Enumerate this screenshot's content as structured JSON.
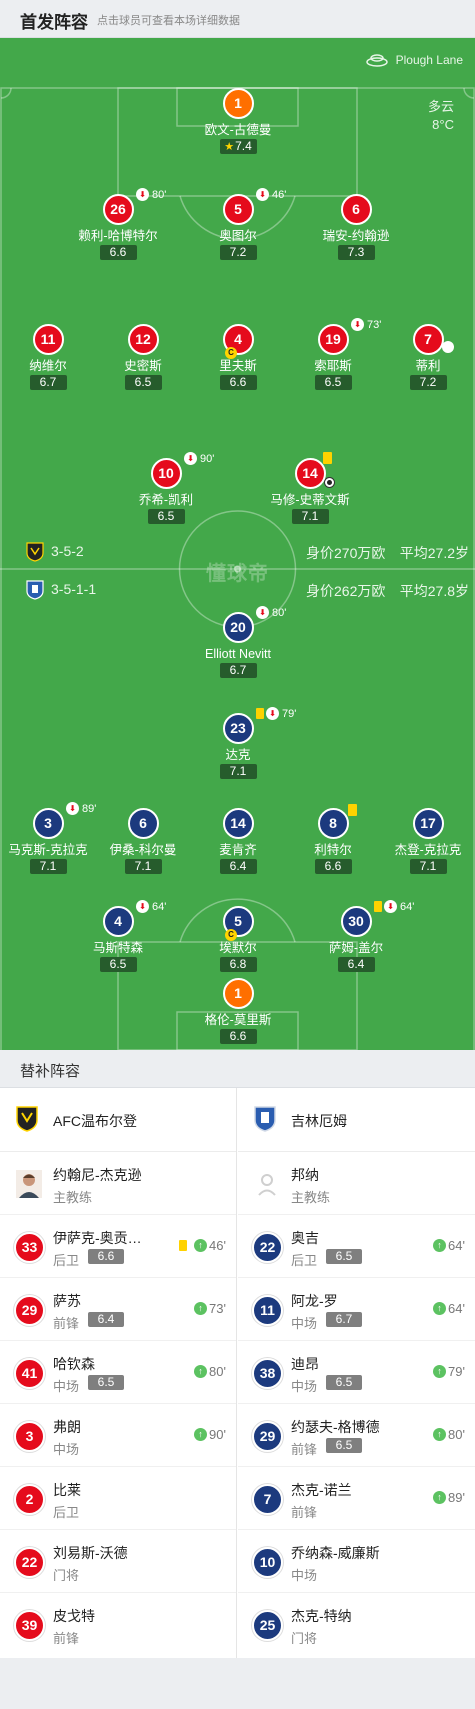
{
  "header": {
    "title": "首发阵容",
    "subtitle": "点击球员可查看本场详细数据"
  },
  "pitch": {
    "venue": "Plough Lane",
    "weather": "多云",
    "temperature": "8°C",
    "watermark": "懂球帝",
    "colors": {
      "grass": "#43a84a",
      "home": "#e50b1c",
      "away": "#1c3a7e",
      "goalkeeper": "#ff6f00"
    }
  },
  "home_summary": {
    "formation": "3-5-2",
    "value": "身价270万欧",
    "avg_age": "平均27.2岁"
  },
  "away_summary": {
    "formation": "3-5-1-1",
    "value": "身价262万欧",
    "avg_age": "平均27.8岁"
  },
  "home_players": [
    {
      "num": "1",
      "name": "欧文-古德曼",
      "rating": "7.4",
      "star": true,
      "gk": true
    },
    {
      "num": "26",
      "name": "赖利-哈博特尔",
      "rating": "6.6",
      "sub_min": "80'"
    },
    {
      "num": "5",
      "name": "奥图尔",
      "rating": "7.2",
      "sub_min": "46'"
    },
    {
      "num": "6",
      "name": "瑞安-约翰逊",
      "rating": "7.3"
    },
    {
      "num": "11",
      "name": "纳维尔",
      "rating": "6.7"
    },
    {
      "num": "12",
      "name": "史密斯",
      "rating": "6.5"
    },
    {
      "num": "4",
      "name": "里夫斯",
      "rating": "6.6",
      "captain": true
    },
    {
      "num": "19",
      "name": "索耶斯",
      "rating": "6.5",
      "sub_min": "73'"
    },
    {
      "num": "7",
      "name": "蒂利",
      "rating": "7.2",
      "misc": true
    },
    {
      "num": "10",
      "name": "乔希-凯利",
      "rating": "6.5",
      "sub_min": "90'"
    },
    {
      "num": "14",
      "name": "马修-史蒂文斯",
      "rating": "7.1",
      "yellow": true,
      "goal": true
    }
  ],
  "away_players": [
    {
      "num": "20",
      "name": "Elliott Nevitt",
      "rating": "6.7",
      "sub_min": "80'"
    },
    {
      "num": "23",
      "name": "达克",
      "rating": "7.1",
      "sub_min": "79'",
      "yellow": true
    },
    {
      "num": "3",
      "name": "马克斯-克拉克",
      "rating": "7.1",
      "sub_min": "89'"
    },
    {
      "num": "6",
      "name": "伊桑-科尔曼",
      "rating": "7.1"
    },
    {
      "num": "14",
      "name": "麦肯齐",
      "rating": "6.4"
    },
    {
      "num": "8",
      "name": "利特尔",
      "rating": "6.6",
      "yellow_only": true
    },
    {
      "num": "17",
      "name": "杰登-克拉克",
      "rating": "7.1"
    },
    {
      "num": "4",
      "name": "马斯特森",
      "rating": "6.5",
      "sub_min": "64'"
    },
    {
      "num": "5",
      "name": "埃默尔",
      "rating": "6.8",
      "captain": true
    },
    {
      "num": "30",
      "name": "萨姆-盖尔",
      "rating": "6.4",
      "sub_min": "64'",
      "yellow": true
    },
    {
      "num": "1",
      "name": "格伦-莫里斯",
      "rating": "6.6",
      "gk": true
    }
  ],
  "subs": {
    "title": "替补阵容",
    "home": {
      "team": "AFC温布尔登",
      "coach": {
        "name": "约翰尼-杰克逊",
        "role": "主教练"
      },
      "players": [
        {
          "num": "33",
          "name": "伊萨克-奥贡…",
          "pos": "后卫",
          "rating": "6.6",
          "min": "46'",
          "yellow": true
        },
        {
          "num": "29",
          "name": "萨苏",
          "pos": "前锋",
          "rating": "6.4",
          "min": "73'"
        },
        {
          "num": "41",
          "name": "哈钦森",
          "pos": "中场",
          "rating": "6.5",
          "min": "80'"
        },
        {
          "num": "3",
          "name": "弗朗",
          "pos": "中场",
          "min": "90'"
        },
        {
          "num": "2",
          "name": "比莱",
          "pos": "后卫"
        },
        {
          "num": "22",
          "name": "刘易斯-沃德",
          "pos": "门将"
        },
        {
          "num": "39",
          "name": "皮戈特",
          "pos": "前锋"
        }
      ]
    },
    "away": {
      "team": "吉林厄姆",
      "coach": {
        "name": "邦纳",
        "role": "主教练"
      },
      "players": [
        {
          "num": "22",
          "name": "奥吉",
          "pos": "后卫",
          "rating": "6.5",
          "min": "64'"
        },
        {
          "num": "11",
          "name": "阿龙-罗",
          "pos": "中场",
          "rating": "6.7",
          "min": "64'"
        },
        {
          "num": "38",
          "name": "迪昂",
          "pos": "中场",
          "rating": "6.5",
          "min": "79'"
        },
        {
          "num": "29",
          "name": "约瑟夫-格博德",
          "pos": "前锋",
          "rating": "6.5",
          "min": "80'"
        },
        {
          "num": "7",
          "name": "杰克-诺兰",
          "pos": "前锋",
          "min": "89'"
        },
        {
          "num": "10",
          "name": "乔纳森-威廉斯",
          "pos": "中场"
        },
        {
          "num": "25",
          "name": "杰克-特纳",
          "pos": "门将"
        }
      ]
    }
  }
}
